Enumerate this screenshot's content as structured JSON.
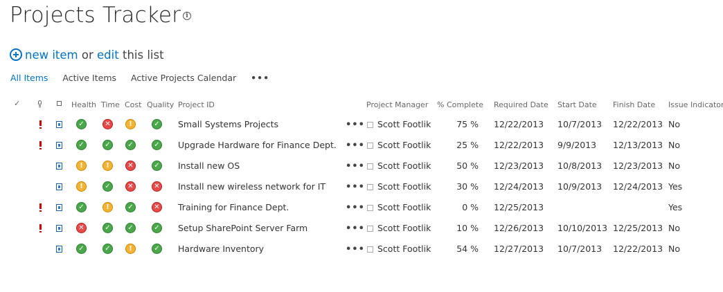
{
  "page": {
    "title": "Projects Tracker",
    "info_icon": "info-icon"
  },
  "actions": {
    "new_item": "new item",
    "or": "or",
    "edit": "edit",
    "this_list": "this list"
  },
  "views": {
    "items": [
      "All Items",
      "Active Items",
      "Active Projects Calendar"
    ],
    "selected": "All Items",
    "more": "•••"
  },
  "table": {
    "headers": {
      "health": "Health",
      "time": "Time",
      "cost": "Cost",
      "quality": "Quality",
      "project_id": "Project ID",
      "project_manager": "Project Manager",
      "pct_complete": "% Complete",
      "required_date": "Required Date",
      "start_date": "Start Date",
      "finish_date": "Finish Date",
      "issue_indicator": "Issue Indicator"
    },
    "rows": [
      {
        "priority": true,
        "health": "green",
        "time": "red",
        "cost": "yellow",
        "quality": "green",
        "project": "Small Systems Projects",
        "manager": "Scott Footlik",
        "pct": "75 %",
        "required": "12/22/2013",
        "start": "10/7/2013",
        "finish": "12/22/2013",
        "issue": "No"
      },
      {
        "priority": true,
        "health": "green",
        "time": "green",
        "cost": "green",
        "quality": "green",
        "project": "Upgrade Hardware for Finance Dept.",
        "manager": "Scott Footlik",
        "pct": "25 %",
        "required": "12/22/2013",
        "start": "9/9/2013",
        "finish": "12/13/2013",
        "issue": "No"
      },
      {
        "priority": false,
        "health": "yellow",
        "time": "yellow",
        "cost": "red",
        "quality": "green",
        "project": "Install new OS",
        "manager": "Scott Footlik",
        "pct": "50 %",
        "required": "12/23/2013",
        "start": "10/8/2013",
        "finish": "12/23/2013",
        "issue": "No"
      },
      {
        "priority": false,
        "health": "yellow",
        "time": "green",
        "cost": "red",
        "quality": "red",
        "project": "Install new wireless network for IT",
        "manager": "Scott Footlik",
        "pct": "30 %",
        "required": "12/24/2013",
        "start": "10/9/2013",
        "finish": "12/24/2013",
        "issue": "Yes"
      },
      {
        "priority": true,
        "health": "green",
        "time": "yellow",
        "cost": "green",
        "quality": "red",
        "project": "Training for Finance Dept.",
        "manager": "Scott Footlik",
        "pct": "0 %",
        "required": "12/25/2013",
        "start": "",
        "finish": "",
        "issue": "Yes"
      },
      {
        "priority": true,
        "health": "red",
        "time": "green",
        "cost": "green",
        "quality": "green",
        "project": "Setup SharePoint Server Farm",
        "manager": "Scott Footlik",
        "pct": "10 %",
        "required": "12/26/2013",
        "start": "10/10/2013",
        "finish": "12/25/2013",
        "issue": "No"
      },
      {
        "priority": false,
        "health": "green",
        "time": "green",
        "cost": "yellow",
        "quality": "green",
        "project": "Hardware Inventory",
        "manager": "Scott Footlik",
        "pct": "54 %",
        "required": "12/27/2013",
        "start": "10/7/2013",
        "finish": "12/22/2013",
        "issue": "No"
      }
    ],
    "row_menu": "•••"
  },
  "colors": {
    "accent": "#0072c6",
    "green": "#4aa84a",
    "red": "#e84a4a",
    "yellow": "#f5b335",
    "priority": "#d00000"
  }
}
